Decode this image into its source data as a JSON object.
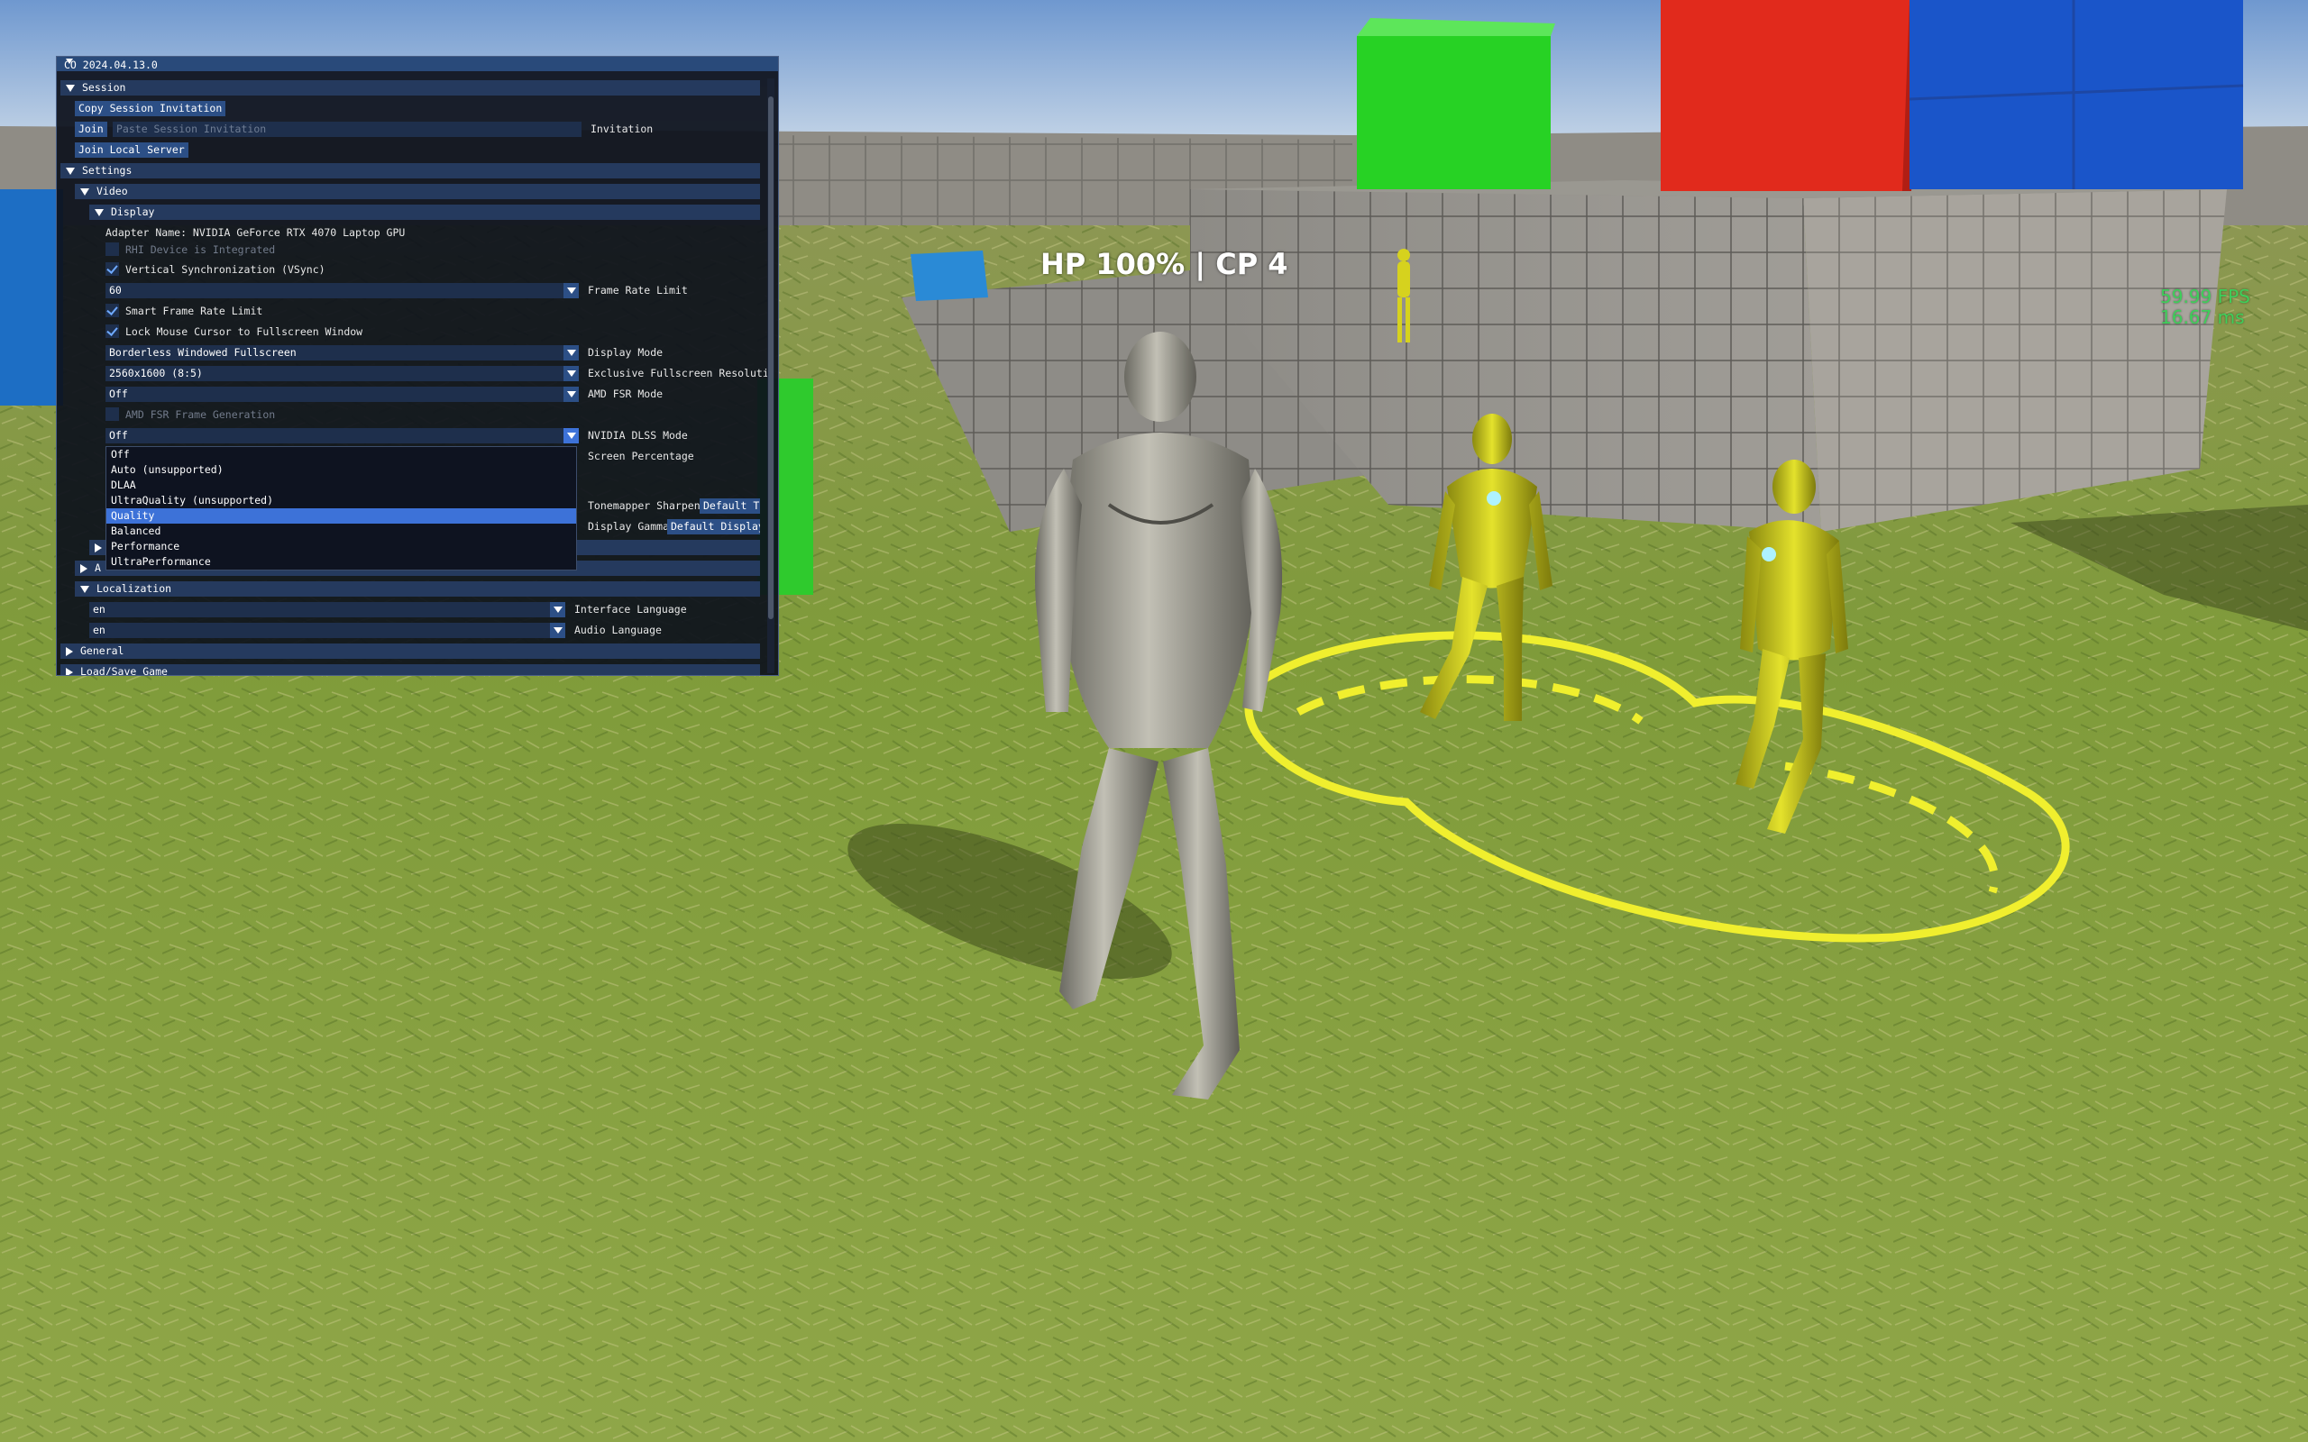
{
  "hud": {
    "status": "HP 100% | CP 4",
    "fps": "59.99 FPS",
    "frame_time": "16.67 ms",
    "colors": {
      "status": "#ffffff",
      "fps": "#3ecf5a"
    }
  },
  "debug_window": {
    "title": "CO 2024.04.13.0",
    "session": {
      "header": "Session",
      "copy_button": "Copy Session Invitation",
      "join_button": "Join",
      "invitation_placeholder": "Paste Session Invitation",
      "invitation_label": "Invitation",
      "join_local_button": "Join Local Server"
    },
    "settings": {
      "header": "Settings",
      "video": {
        "header": "Video",
        "display": {
          "header": "Display",
          "adapter": "Adapter Name: NVIDIA GeForce RTX 4070 Laptop GPU",
          "rhi_integrated": "RHI Device is Integrated",
          "vsync": "Vertical Synchronization (VSync)",
          "frame_rate_value": "60",
          "frame_rate_label": "Frame Rate Limit",
          "smart_frame_rate": "Smart Frame Rate Limit",
          "lock_mouse": "Lock Mouse Cursor to Fullscreen Window",
          "display_mode_value": "Borderless Windowed Fullscreen",
          "display_mode_label": "Display Mode",
          "resolution_value": "2560x1600 (8:5)",
          "resolution_label": "Exclusive Fullscreen Resoluti",
          "fsr_value": "Off",
          "fsr_label": "AMD FSR Mode",
          "fsr_frame_gen": "AMD FSR Frame Generation",
          "dlss_value": "Off",
          "dlss_label": "NVIDIA DLSS Mode",
          "screen_percentage_label": "Screen Percentage",
          "tonemapper_label": "Tonemapper Sharpen",
          "tonemapper_button": "Default To",
          "gamma_label": "Display Gamma",
          "gamma_button": "Default Display"
        },
        "dlss_options": [
          "Off",
          "Auto (unsupported)",
          "DLAA",
          "UltraQuality (unsupported)",
          "Quality",
          "Balanced",
          "Performance",
          "UltraPerformance"
        ],
        "dlss_selected": "Quality",
        "collapsed_audio": "A"
      },
      "localization": {
        "header": "Localization",
        "interface_value": "en",
        "interface_label": "Interface Language",
        "audio_value": "en",
        "audio_label": "Audio Language"
      }
    },
    "general_header": "General",
    "load_save_header": "Load/Save Game",
    "colors": {
      "window_bg": "#0d111c",
      "title_bar": "#294a7a",
      "header": "#253a5e",
      "button": "#2c4f86",
      "selection": "#3d72d8",
      "check": "#6ea9ff"
    }
  }
}
